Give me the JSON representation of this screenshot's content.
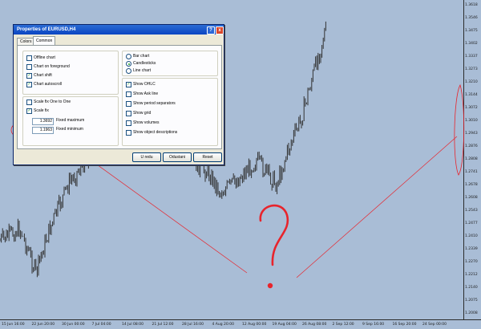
{
  "price_scale": [
    "1.3618",
    "1.3546",
    "1.3475",
    "1.3402",
    "1.3337",
    "1.3273",
    "1.3210",
    "1.3144",
    "1.3072",
    "1.3010",
    "1.2943",
    "1.2876",
    "1.2808",
    "1.2741",
    "1.2678",
    "1.2608",
    "1.2543",
    "1.2477",
    "1.2410",
    "1.2339",
    "1.2270",
    "1.2212",
    "1.2140",
    "1.2075",
    "1.2008"
  ],
  "time_axis": [
    "15 Jun 16:00",
    "22 Jun 20:00",
    "30 Jun 00:00",
    "7 Jul 04:00",
    "14 Jul 08:00",
    "21 Jul 12:00",
    "28 Jul 16:00",
    "4 Aug 20:00",
    "12 Aug 00:00",
    "19 Aug 04:00",
    "26 Aug 08:00",
    "2 Sep 12:00",
    "9 Sep 16:00",
    "16 Sep 20:00",
    "24 Sep 00:00"
  ],
  "annotation": {
    "color": "#e8242c"
  },
  "chart_colors": {
    "background": "#a9bdd6",
    "candles": "#333333"
  },
  "dialog": {
    "title": "Properties of EURUSD,H4",
    "help_button": "?",
    "close_button": "x",
    "tabs": [
      {
        "label": "Colors",
        "selected": false
      },
      {
        "label": "Common",
        "selected": true
      }
    ],
    "left_options": [
      {
        "label": "Offline chart",
        "checked": false
      },
      {
        "label": "Chart on foreground",
        "checked": false
      },
      {
        "label": "Chart shift",
        "checked": true
      },
      {
        "label": "Chart autoscroll",
        "checked": true
      }
    ],
    "scale_options": [
      {
        "label": "Scale fix One to One",
        "checked": false
      },
      {
        "label": "Scale fix",
        "checked": true
      }
    ],
    "fixed_maximum": {
      "value": "1.3692",
      "label": "Fixed maximum"
    },
    "fixed_minimum": {
      "value": "1.1963",
      "label": "Fixed minimum"
    },
    "chart_type_options": [
      {
        "label": "Bar chart",
        "selected": false
      },
      {
        "label": "Candlesticks",
        "selected": true
      },
      {
        "label": "Line chart",
        "selected": false
      }
    ],
    "right_options": [
      {
        "label": "Show OHLC",
        "checked": true
      },
      {
        "label": "Show Ask line",
        "checked": false
      },
      {
        "label": "Show period separators",
        "checked": false
      },
      {
        "label": "Show grid",
        "checked": false
      },
      {
        "label": "Show volumes",
        "checked": false
      },
      {
        "label": "Show object descriptions",
        "checked": false
      }
    ],
    "buttons": {
      "ok": "U redu",
      "cancel": "Odustani",
      "reset": "Reset"
    }
  }
}
